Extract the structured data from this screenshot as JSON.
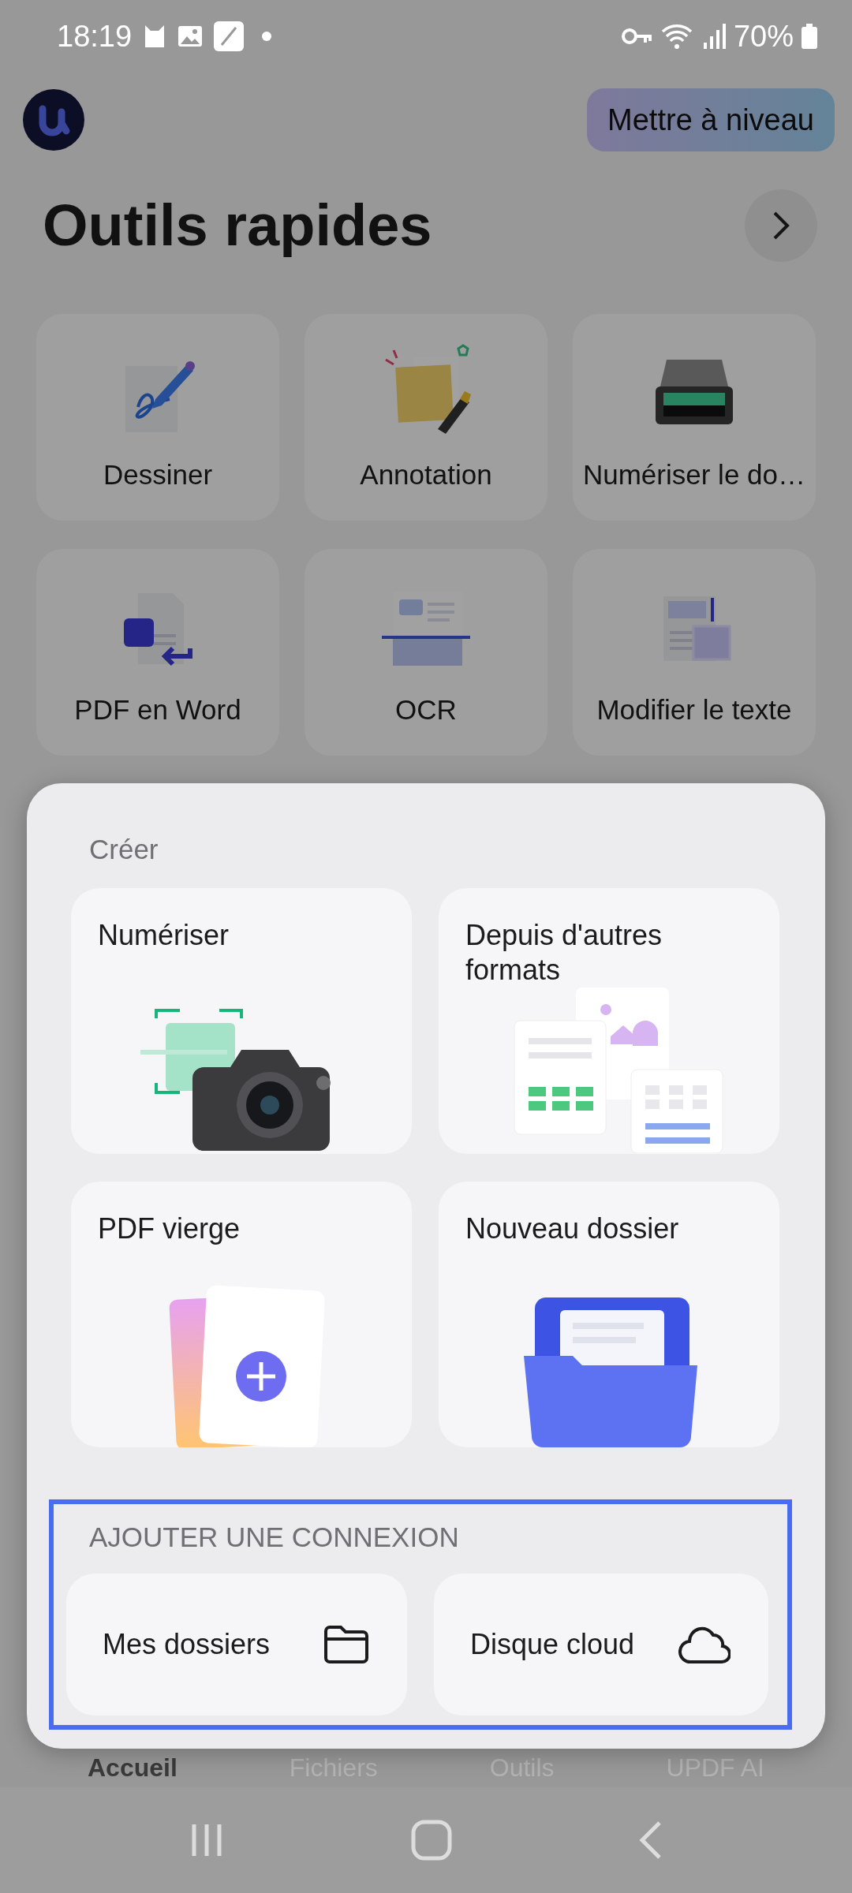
{
  "status_bar": {
    "time": "18:19",
    "battery": "70%"
  },
  "header": {
    "upgrade_button": "Mettre à niveau"
  },
  "quick_tools": {
    "title": "Outils rapides",
    "tools": [
      {
        "label": "Dessiner"
      },
      {
        "label": "Annotation"
      },
      {
        "label": "Numériser le do…"
      },
      {
        "label": "PDF en Word"
      },
      {
        "label": "OCR"
      },
      {
        "label": "Modifier le texte"
      }
    ]
  },
  "create_sheet": {
    "title": "Créer",
    "options": [
      {
        "label": "Numériser"
      },
      {
        "label": "Depuis d'autres formats"
      },
      {
        "label": "PDF vierge"
      },
      {
        "label": "Nouveau dossier"
      }
    ],
    "connection": {
      "title": "AJOUTER UNE CONNEXION",
      "options": [
        {
          "label": "Mes dossiers"
        },
        {
          "label": "Disque cloud"
        }
      ]
    }
  },
  "bottom_nav": {
    "tabs": [
      {
        "label": "Accueil",
        "selected": true
      },
      {
        "label": "Fichiers",
        "selected": false
      },
      {
        "label": "Outils",
        "selected": false
      },
      {
        "label": "UPDF AI",
        "selected": false
      }
    ]
  }
}
